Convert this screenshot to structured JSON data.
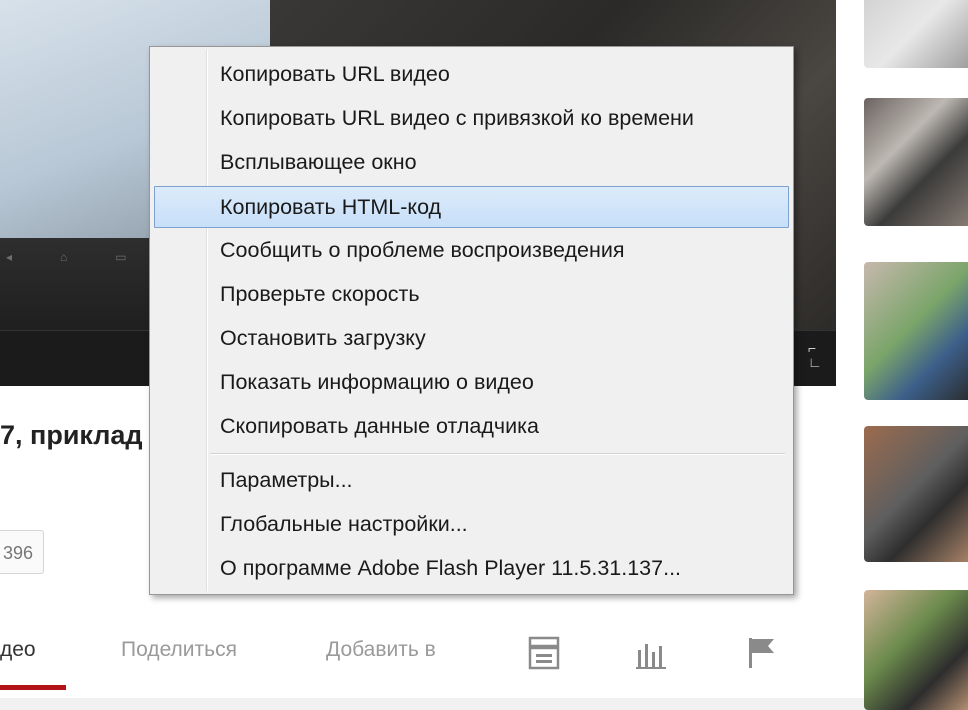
{
  "video": {
    "title_fragment": "7, приклад"
  },
  "stats": {
    "view_count_fragment": "396"
  },
  "actions": {
    "tab_video": "део",
    "tab_share": "Поделиться",
    "tab_add": "Добавить в",
    "icons": [
      "transcript-icon",
      "stats-icon",
      "flag-icon"
    ]
  },
  "context_menu": {
    "highlighted_index": 3,
    "items": [
      {
        "label": "Копировать URL видео"
      },
      {
        "label": "Копировать URL видео с привязкой ко времени"
      },
      {
        "label": "Всплывающее окно"
      },
      {
        "label": "Копировать HTML-код"
      },
      {
        "label": "Сообщить о проблеме воспроизведения"
      },
      {
        "label": "Проверьте скорость"
      },
      {
        "label": "Остановить загрузку"
      },
      {
        "label": "Показать информацию о видео"
      },
      {
        "label": "Скопировать данные отладчика"
      },
      {
        "label": "Параметры..."
      },
      {
        "label": "Глобальные настройки..."
      },
      {
        "label": "О программе Adobe Flash Player 11.5.31.137..."
      }
    ]
  },
  "colors": {
    "menu_background": "#f0f0f0",
    "menu_highlight": "#c7dff8",
    "menu_highlight_border": "#7da2ce",
    "active_tab_underline": "#b31217"
  }
}
